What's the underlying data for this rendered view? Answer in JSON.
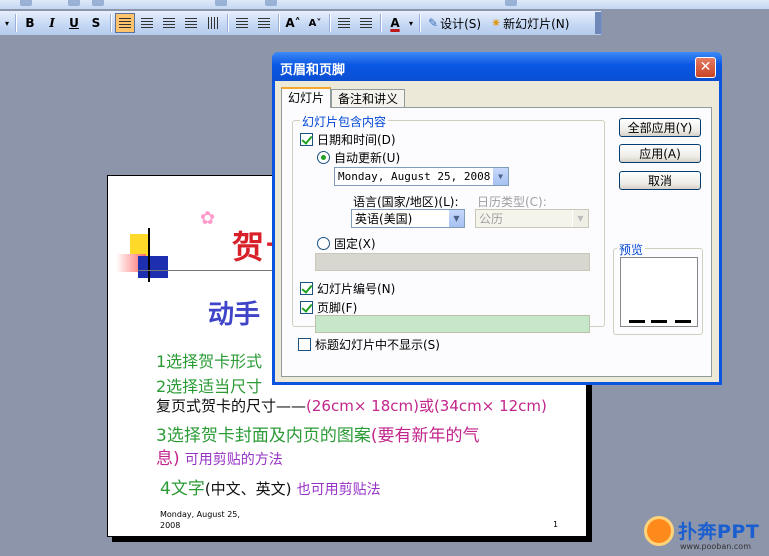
{
  "toolbar": {
    "bold": "B",
    "italic": "I",
    "underline": "U",
    "shadow": "S",
    "font_grow": "A˄",
    "font_shrink": "A˅",
    "font_color": "A",
    "design_label": "设计(S)",
    "new_slide_label": "新幻灯片(N)"
  },
  "slide": {
    "title_visible": "贺卡",
    "subtitle_visible": "动手",
    "line1": "1选择贺卡形式",
    "line2": "2选择适当尺寸",
    "line3_text": "复页式贺卡的尺寸——",
    "line3_dims": "(26cm× 18cm)或(34cm× 12cm)",
    "line4_main": "3选择贺卡封面及内页的图案",
    "line4_paren": "(要有新年的气",
    "line5_a": "息)",
    "line5_b": "可用剪贴的方法",
    "line6_num": "4文字",
    "line6_paren": "(中文、英文)",
    "line6_hint": "也可用剪贴法",
    "footer_date": "Monday, August 25, 2008",
    "page_number": "1"
  },
  "dialog": {
    "title": "页眉和页脚",
    "close_glyph": "✕",
    "tabs": [
      {
        "label": "幻灯片",
        "selected": true
      },
      {
        "label": "备注和讲义",
        "selected": false
      }
    ],
    "group_label": "幻灯片包含内容",
    "date_time": {
      "label": "日期和时间(D)",
      "checked": true
    },
    "auto_update": {
      "label": "自动更新(U)",
      "selected": true
    },
    "date_format_value": "Monday, August 25, 2008",
    "language_label": "语言(国家/地区)(L):",
    "language_value": "英语(美国)",
    "calendar_label": "日历类型(C):",
    "calendar_value": "公历",
    "fixed": {
      "label": "固定(X)",
      "selected": false
    },
    "fixed_value": "",
    "slide_number": {
      "label": "幻灯片编号(N)",
      "checked": true
    },
    "footer": {
      "label": "页脚(F)",
      "checked": true
    },
    "footer_value": "",
    "hide_on_title": {
      "label": "标题幻灯片中不显示(S)",
      "checked": false
    },
    "buttons": {
      "apply_all": "全部应用(Y)",
      "apply": "应用(A)",
      "cancel": "取消"
    },
    "preview_label": "预览"
  },
  "watermark": {
    "brand": "扑奔PPT",
    "url": "www.pooban.com"
  },
  "colors": {
    "xp_title_blue": "#0a54e0",
    "slide_title_red": "#d8202a",
    "slide_subtitle_blue": "#3f44c8",
    "green_text": "#2b9b36",
    "magenta_text": "#c2268c",
    "footer_field_green": "#c6e7c9"
  }
}
